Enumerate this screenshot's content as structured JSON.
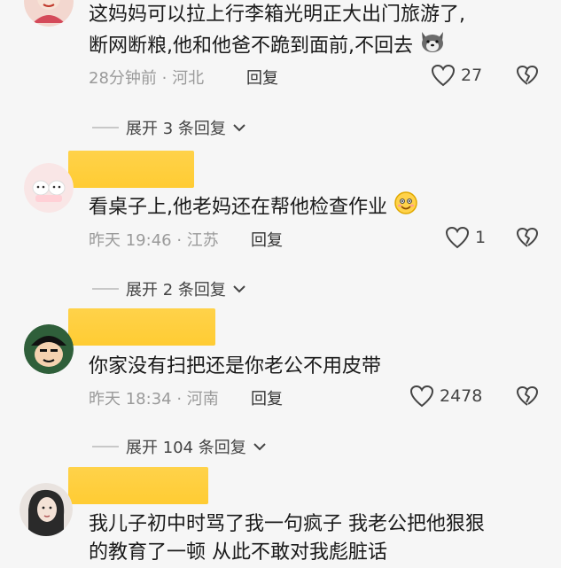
{
  "comments": [
    {
      "lines": [
        "这妈妈可以拉上行李箱光明正大出门旅游了,",
        "断网断粮,他和他爸不跪到面前,不回去"
      ],
      "emoji": "husky-emoji",
      "time_location": "28分钟前 · 河北",
      "reply_label": "回复",
      "likes": "27",
      "expand_label": "展开 3 条回复"
    },
    {
      "lines": [
        "看桌子上,他老妈还在帮他检查作业"
      ],
      "emoji": "smile-emoji",
      "time_location": "昨天 19:46 · 江苏",
      "reply_label": "回复",
      "likes": "1",
      "expand_label": "展开 2 条回复"
    },
    {
      "lines": [
        "你家没有扫把还是你老公不用皮带"
      ],
      "time_location": "昨天 18:34 · 河南",
      "reply_label": "回复",
      "likes": "2478",
      "expand_label": "展开 104 条回复"
    },
    {
      "lines": [
        "我儿子初中时骂了我一句疯子 我老公把他狠狠",
        "的教育了一顿 从此不敢对我彪脏话"
      ]
    }
  ],
  "colors": {
    "name_highlight": "#ffcc33",
    "meta_gray": "#9a9a9a"
  }
}
